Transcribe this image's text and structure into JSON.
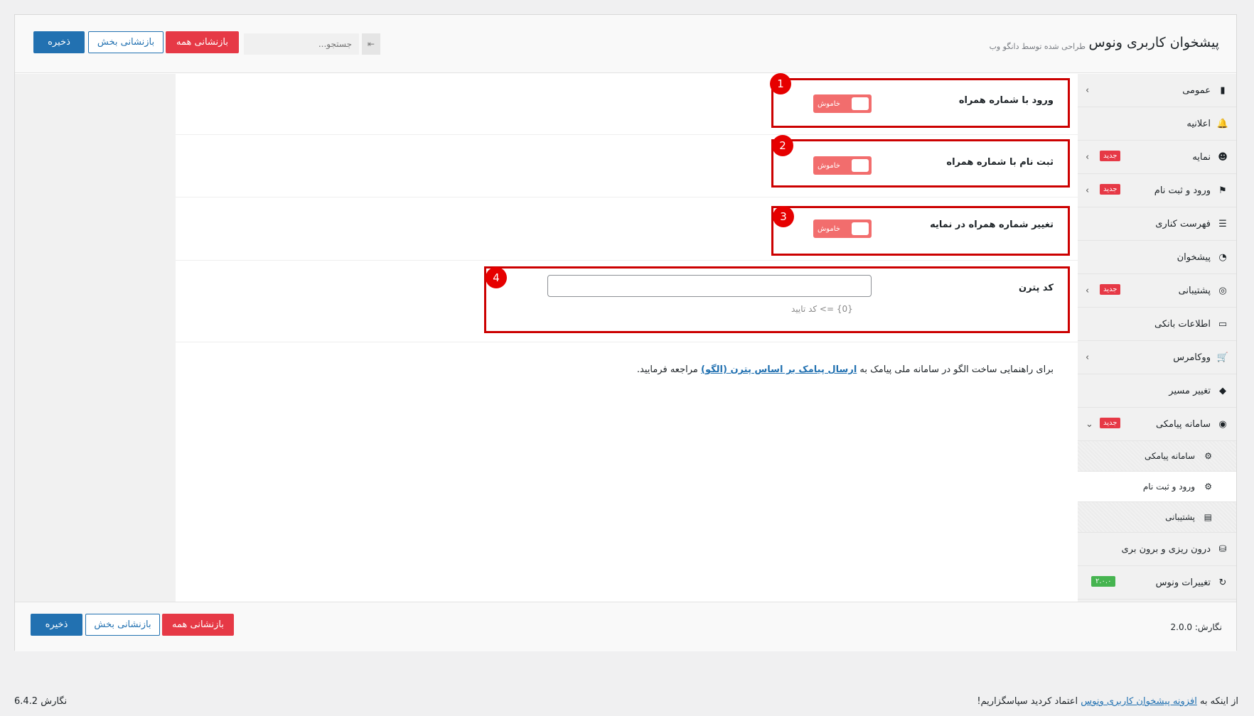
{
  "header": {
    "title": "پیشخوان کاربری ونوس",
    "subtitle": "طراحی شده توسط دانگو وب",
    "search_placeholder": "جستجو...",
    "reset_all_label": "بازنشانی همه",
    "reset_section_label": "بازنشانی بخش",
    "save_label": "ذخیره"
  },
  "sidebar": {
    "items": [
      {
        "label": "عمومی",
        "icon": "bookmark-icon",
        "chevron": "›",
        "badge": ""
      },
      {
        "label": "اعلانیه",
        "icon": "bell-icon",
        "chevron": "",
        "badge": ""
      },
      {
        "label": "نمایه",
        "icon": "user-circle-icon",
        "chevron": "›",
        "badge": "جدید"
      },
      {
        "label": "ورود و ثبت نام",
        "icon": "signpost-icon",
        "chevron": "›",
        "badge": "جدید"
      },
      {
        "label": "فهرست کناری",
        "icon": "list-icon",
        "chevron": "",
        "badge": ""
      },
      {
        "label": "پیشخوان",
        "icon": "dashboard-icon",
        "chevron": "",
        "badge": ""
      },
      {
        "label": "پشتیبانی",
        "icon": "lifebuoy-icon",
        "chevron": "›",
        "badge": "جدید"
      },
      {
        "label": "اطلاعات بانکی",
        "icon": "credit-card-icon",
        "chevron": "",
        "badge": ""
      },
      {
        "label": "ووکامرس",
        "icon": "cart-icon",
        "chevron": "›",
        "badge": ""
      },
      {
        "label": "تغییر مسیر",
        "icon": "route-icon",
        "chevron": "",
        "badge": ""
      },
      {
        "label": "سامانه پیامکی",
        "icon": "chat-icon",
        "chevron": "⌄",
        "badge": "جدید"
      }
    ],
    "sub_items": [
      {
        "label": "سامانه پیامکی",
        "icon": "gears-icon"
      },
      {
        "label": "ورود و ثبت نام",
        "icon": "users-gear-icon"
      },
      {
        "label": "پشتیبانی",
        "icon": "ticket-icon"
      }
    ],
    "bottom_items": [
      {
        "label": "درون ریزی و برون بری",
        "icon": "database-icon",
        "badge": ""
      },
      {
        "label": "تغییرات ونوس",
        "icon": "refresh-icon",
        "badge": "۲.۰.۰"
      }
    ]
  },
  "fields": [
    {
      "label": "ورود با شماره همراه",
      "toggle": "خاموش",
      "marker": "1"
    },
    {
      "label": "ثبت نام با شماره همراه",
      "toggle": "خاموش",
      "marker": "2"
    },
    {
      "label": "تغییر شماره همراه در نمایه",
      "toggle": "خاموش",
      "marker": "3"
    },
    {
      "label": "کد پترن",
      "hint": "{0} => کد تایید",
      "marker": "4",
      "value": ""
    }
  ],
  "guide": {
    "before": "برای راهنمایی ساخت الگو در سامانه ملی پیامک به ",
    "link": "ارسال پیامک بر اساس پترن (الگو)",
    "after": " مراجعه فرمایید."
  },
  "footer": {
    "version_label": "نگارش:",
    "version_value": "2.0.0"
  },
  "wp_footer": {
    "thanks_before": "از اینکه به ",
    "thanks_link": "افزونه پیشخوان کاربری ونوس",
    "thanks_after": " اعتماد کردید سپاسگزاریم!",
    "version": "نگارش 6.4.2"
  }
}
